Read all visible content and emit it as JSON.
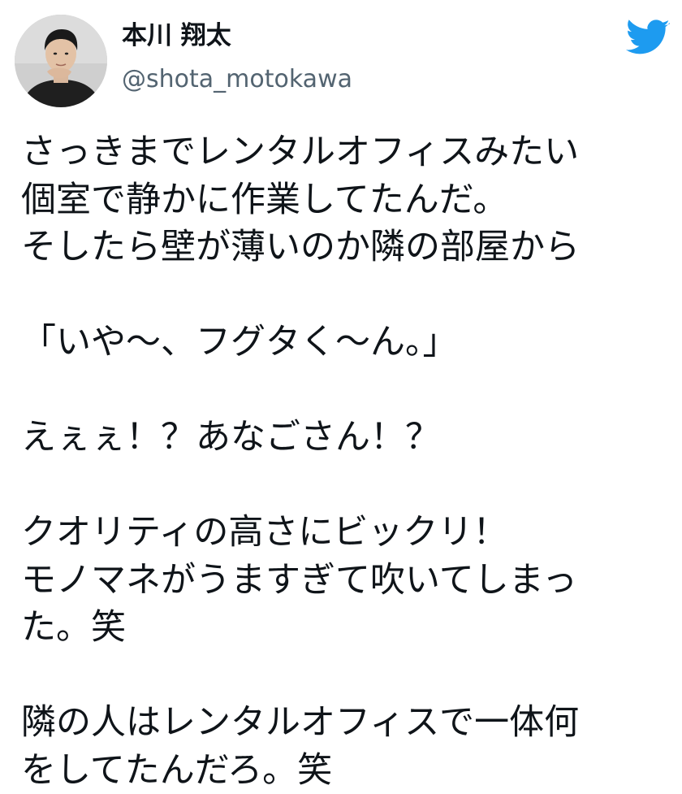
{
  "tweet": {
    "author": {
      "display_name": "本川 翔太",
      "handle": "@shota_motokawa"
    },
    "brand_icon": "twitter-bird-icon",
    "colors": {
      "twitter_blue": "#1D9BF0",
      "handle_gray": "#536471",
      "text": "#0F1419"
    },
    "lines": [
      "さっきまでレンタルオフィスみたい",
      "個室で静かに作業してたんだ。",
      "そしたら壁が薄いのか隣の部屋から",
      "",
      "「いや〜、フグタく〜ん。」",
      "",
      "えぇぇ！？あなごさん！？",
      "",
      "クオリティの高さにビックリ！",
      "モノマネがうますぎて吹いてしまっ",
      "た。笑",
      "",
      "隣の人はレンタルオフィスで一体何",
      "をしてたんだろ。笑"
    ]
  }
}
